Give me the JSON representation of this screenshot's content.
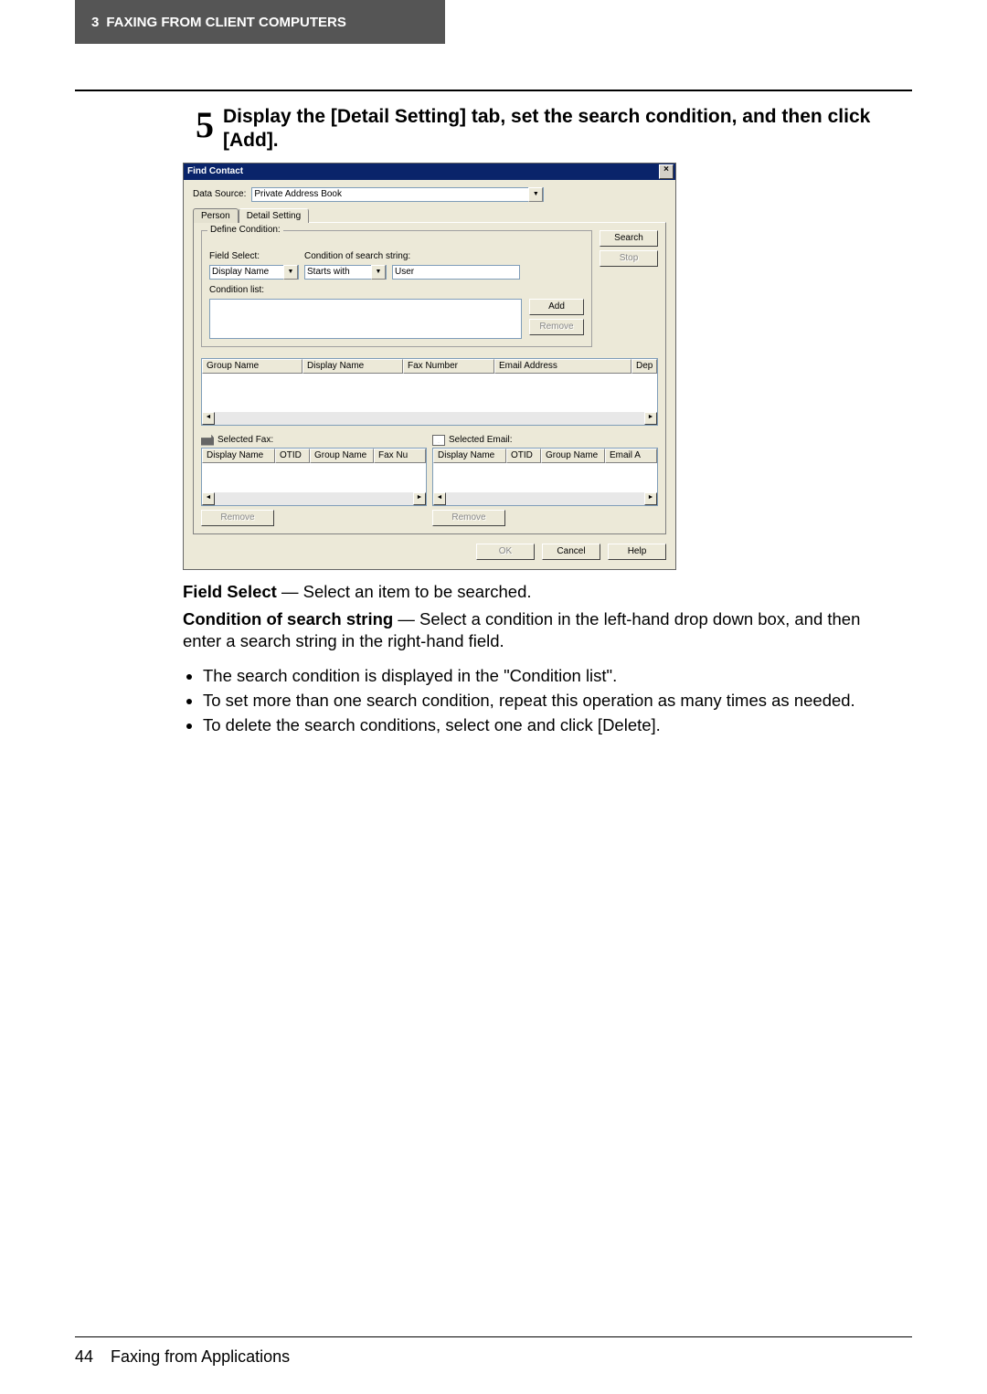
{
  "header": {
    "chapter_number": "3",
    "chapter_title": "FAXING FROM CLIENT COMPUTERS"
  },
  "step": {
    "number": "5",
    "text": "Display the [Detail Setting] tab, set the search condition, and then click [Add]."
  },
  "dialog": {
    "title": "Find Contact",
    "close_label": "×",
    "data_source_label": "Data Source:",
    "data_source_value": "Private Address Book",
    "tabs": {
      "person": "Person",
      "detail": "Detail Setting"
    },
    "groupbox_legend": "Define Condition:",
    "field_select_label": "Field Select:",
    "field_select_value": "Display Name",
    "condition_label": "Condition of search string:",
    "condition_operator": "Starts with",
    "condition_string": "User",
    "condition_list_label": "Condition list:",
    "add_button": "Add",
    "remove_button": "Remove",
    "search_button": "Search",
    "stop_button": "Stop",
    "results_headers": {
      "group_name": "Group Name",
      "display_name": "Display Name",
      "fax_number": "Fax Number",
      "email_address": "Email Address",
      "dep": "Dep"
    },
    "selected_fax_label": "Selected Fax:",
    "selected_email_label": "Selected Email:",
    "selected_headers": {
      "display_name": "Display Name",
      "otid": "OTID",
      "group_name": "Group Name",
      "fax_num": "Fax Nu",
      "email_a": "Email A"
    },
    "bottom_remove": "Remove",
    "ok_button": "OK",
    "cancel_button": "Cancel",
    "help_button": "Help"
  },
  "desc": {
    "field_select_bold": "Field Select",
    "field_select_rest": " — Select an item to be searched.",
    "condition_bold": "Condition of search string",
    "condition_rest": " — Select a condition in the left-hand drop down box, and then enter a search string in the right-hand field.",
    "bullets": [
      "The search condition is displayed in the \"Condition list\".",
      "To set more than one search condition, repeat this operation as many times as needed.",
      "To delete the search conditions, select one and click [Delete]."
    ]
  },
  "footer": {
    "page_number": "44",
    "section": "Faxing from Applications"
  }
}
